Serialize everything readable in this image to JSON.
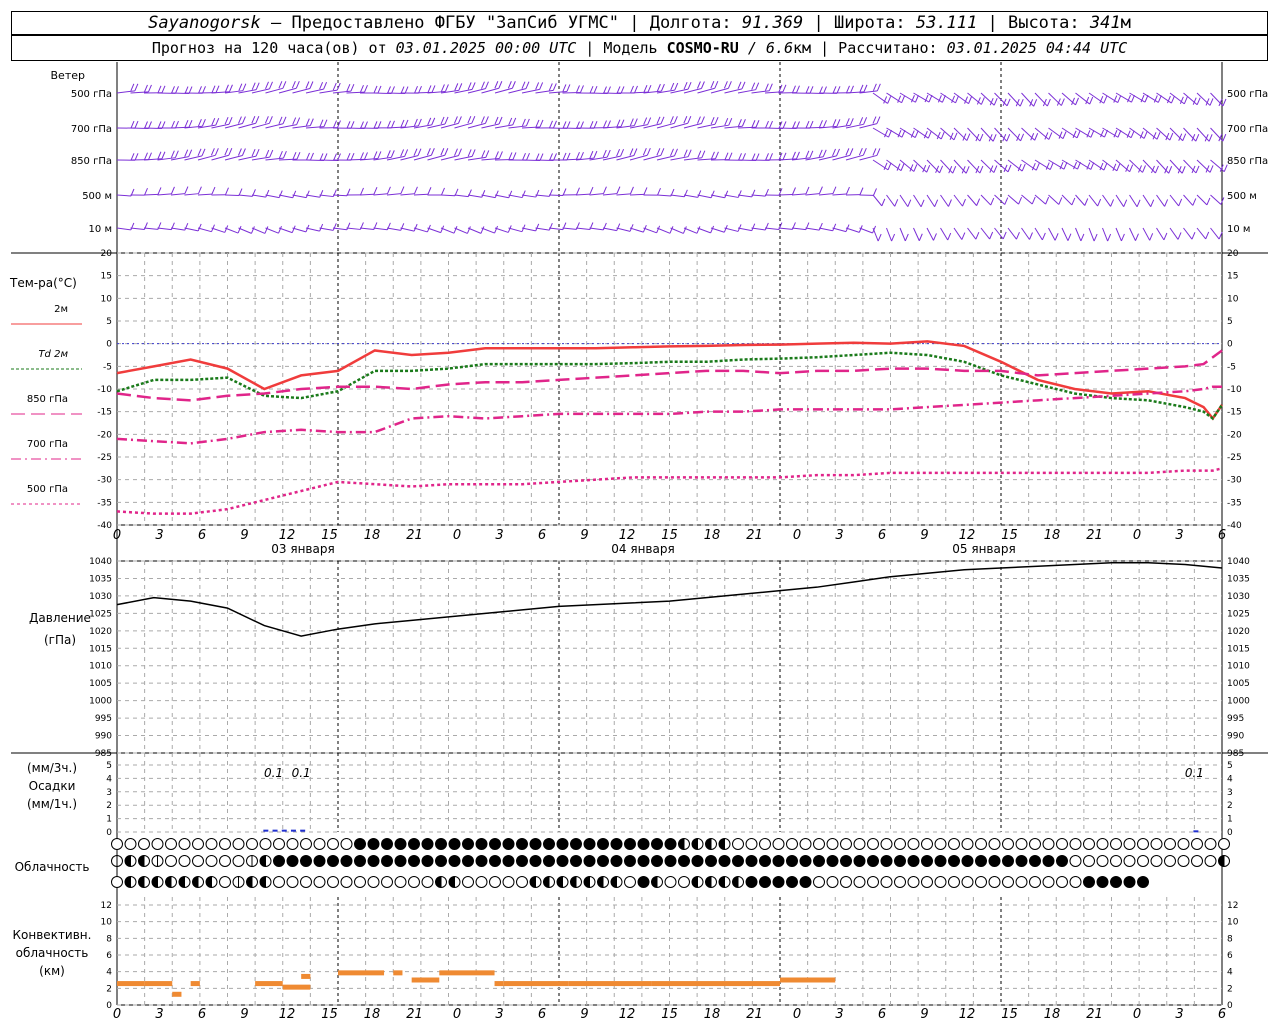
{
  "header": {
    "station": "Sayanogorsk",
    "sep1": " — ",
    "provider": "Предоставлено ФГБУ \"ЗапСиб УГМС\"",
    "lon_label": " | Долгота: ",
    "lon": "91.369",
    "lat_label": " | Широта: ",
    "lat": "53.111",
    "alt_label": " | Высота: ",
    "alt": "341",
    "alt_unit": "м",
    "forecast_label": "Прогноз на 120 часа(ов) от ",
    "forecast_time": "03.01.2025 00:00 UTC",
    "model_label": "  | Модель ",
    "model": "COSMO-RU",
    "model_res": " / 6.6",
    "model_res_unit": "км",
    "calc_label": " | Рассчитано: ",
    "calc_time": "03.01.2025 04:44 UTC"
  },
  "wind_panel": {
    "title": "Ветер",
    "levels": [
      "500 гПа",
      "700 гПа",
      "850 гПа",
      "500 м",
      "10  м"
    ],
    "color": "#7b2fd6"
  },
  "temp_panel": {
    "title": "Тем-ра(°C)",
    "legend": [
      {
        "label": "2м",
        "color": "#f03c3c",
        "dash": "solid"
      },
      {
        "label": "Td  2м",
        "color": "#1a7a1a",
        "dash": "dot"
      },
      {
        "label": "850 гПа",
        "color": "#e0258a",
        "dash": "long"
      },
      {
        "label": "700 гПа",
        "color": "#e0258a",
        "dash": "dashdot"
      },
      {
        "label": "500 гПа",
        "color": "#e0258a",
        "dash": "dense"
      }
    ],
    "yticks": [
      "20",
      "15",
      "10",
      "5",
      "0",
      "-5",
      "-10",
      "-15",
      "-20",
      "-25",
      "-30",
      "-35",
      "-40"
    ]
  },
  "pressure_panel": {
    "title": "Давление",
    "unit": "(гПа)",
    "yticks": [
      "1040",
      "1035",
      "1030",
      "1025",
      "1020",
      "1015",
      "1010",
      "1005",
      "1000",
      "995",
      "990",
      "985"
    ]
  },
  "precip_panel": {
    "unit_top": "(мм/3ч.)",
    "title": "Осадки",
    "unit_bottom": "(мм/1ч.)",
    "yticks": [
      "5",
      "4",
      "3",
      "2",
      "1",
      "0"
    ],
    "labels": [
      {
        "hour": 17,
        "text": "0.1"
      },
      {
        "hour": 20,
        "text": "0.1"
      },
      {
        "hour": 117,
        "text": "0.1"
      }
    ]
  },
  "cloud_panel": {
    "title": "Облачность"
  },
  "conv_panel": {
    "title_1": "Конвективн.",
    "title_2": "облачность",
    "unit": "(км)",
    "yticks": [
      "12",
      "10",
      "8",
      "6",
      "4",
      "2",
      "0"
    ]
  },
  "time_axis": {
    "ticks": [
      "0",
      "3",
      "6",
      "9",
      "12",
      "15",
      "18",
      "21",
      "0",
      "3",
      "6",
      "9",
      "12",
      "15",
      "18",
      "21",
      "0",
      "3",
      "6",
      "9",
      "12",
      "15",
      "18",
      "21",
      "0",
      "3",
      "6"
    ],
    "dates": [
      "03 января",
      "04 января",
      "05 января"
    ]
  },
  "chart_data": {
    "type": "line",
    "x_unit": "hours from 03.01.2025 00:00 UTC",
    "x": [
      0,
      3,
      6,
      9,
      12,
      15,
      18,
      21,
      24,
      27,
      30,
      33,
      36,
      39,
      42,
      45,
      48,
      51,
      54,
      57,
      60,
      63,
      66,
      69,
      72,
      75,
      78,
      81,
      84,
      87,
      90,
      93,
      96,
      99,
      102,
      105,
      108,
      111,
      114,
      117,
      120
    ],
    "temperature": {
      "ylim": [
        -40,
        20
      ],
      "series": [
        {
          "name": "2м",
          "values": [
            -6.5,
            -5,
            -3.5,
            -5.5,
            -10,
            -7,
            -6,
            -1.5,
            -2.5,
            -2,
            -1,
            -1,
            -1,
            -1,
            -0.8,
            -0.6,
            -0.5,
            -0.3,
            -0.2,
            0,
            0.2,
            0,
            0.5,
            -0.5,
            -4,
            -8,
            -10,
            -11,
            -10.5,
            -12,
            -14,
            -16.5,
            -13.5
          ]
        },
        {
          "name": "Td  2м",
          "values": [
            -10.5,
            -8,
            -8,
            -7.5,
            -11.5,
            -12,
            -10.5,
            -6,
            -6,
            -5.5,
            -4.5,
            -4.5,
            -4.5,
            -4.5,
            -4.3,
            -4,
            -4,
            -3.5,
            -3.3,
            -3,
            -2.5,
            -2,
            -2.5,
            -4,
            -7,
            -9,
            -11,
            -12,
            -12.5,
            -14,
            -15,
            -16.5,
            -13.5
          ]
        },
        {
          "name": "850 гПа",
          "values": [
            -11,
            -12,
            -12.5,
            -11.5,
            -11,
            -10,
            -9.5,
            -9.5,
            -10,
            -9,
            -8.5,
            -8.5,
            -8,
            -7.5,
            -7,
            -6.5,
            -6,
            -6,
            -6.5,
            -6,
            -6,
            -5.5,
            -5.5,
            -6,
            -6,
            -7,
            -6.5,
            -6,
            -5.5,
            -5,
            -4.5,
            -3,
            -1.5
          ]
        },
        {
          "name": "700 гПа",
          "values": [
            -21,
            -21.5,
            -22,
            -21,
            -19.5,
            -19,
            -19.5,
            -19.5,
            -16.5,
            -16,
            -16.5,
            -16,
            -15.5,
            -15.5,
            -15.5,
            -15.5,
            -15,
            -15,
            -14.5,
            -14.5,
            -14.5,
            -14.5,
            -14,
            -13.5,
            -13,
            -12.5,
            -12,
            -11.5,
            -11,
            -10.5,
            -10,
            -9.5,
            -9.5
          ]
        },
        {
          "name": "500 гПа",
          "values": [
            -37,
            -37.5,
            -37.5,
            -36.5,
            -34.5,
            -32.5,
            -30.5,
            -31,
            -31.5,
            -31,
            -31,
            -31,
            -30.5,
            -30,
            -29.5,
            -29.5,
            -29.5,
            -29.5,
            -29.5,
            -29,
            -29,
            -28.5,
            -28.5,
            -28.5,
            -28.5,
            -28.5,
            -28.5,
            -28.5,
            -28.5,
            -28,
            -28,
            -28,
            -27.5
          ]
        }
      ],
      "x": [
        0,
        4,
        8,
        12,
        16,
        20,
        24,
        28,
        32,
        36,
        40,
        44,
        48,
        52,
        56,
        60,
        64,
        68,
        72,
        76,
        80,
        84,
        88,
        92,
        96,
        100,
        104,
        108,
        112,
        116,
        118,
        119,
        120
      ]
    },
    "pressure": {
      "ylim": [
        985,
        1040
      ],
      "x": [
        0,
        4,
        8,
        12,
        16,
        20,
        24,
        28,
        32,
        36,
        40,
        44,
        48,
        52,
        56,
        60,
        64,
        68,
        72,
        76,
        80,
        84,
        88,
        92,
        96,
        100,
        104,
        108,
        112,
        116,
        120
      ],
      "values": [
        1027.5,
        1029.5,
        1028.5,
        1026.5,
        1021.5,
        1018.5,
        1020.5,
        1022,
        1023,
        1024,
        1025,
        1026,
        1027,
        1027.5,
        1028,
        1028.5,
        1029.5,
        1030.5,
        1031.5,
        1032.5,
        1034,
        1035.5,
        1036.5,
        1037.5,
        1038,
        1038.5,
        1039,
        1039.5,
        1039.5,
        1039,
        1038
      ]
    },
    "precipitation": {
      "ylim": [
        0,
        5
      ],
      "x": [
        16,
        17,
        18,
        19,
        20,
        117
      ],
      "values": [
        0.1,
        0.1,
        0.1,
        0.1,
        0.1,
        0.05
      ]
    },
    "convective_cloud_km": {
      "ylim": [
        0,
        14
      ],
      "segments": [
        {
          "x0": 0,
          "x1": 3,
          "y": 3
        },
        {
          "x0": 3,
          "x1": 6,
          "y": 3
        },
        {
          "x0": 6,
          "x1": 7,
          "y": 1.5
        },
        {
          "x0": 8,
          "x1": 9,
          "y": 3
        },
        {
          "x0": 15,
          "x1": 18,
          "y": 3
        },
        {
          "x0": 18,
          "x1": 21,
          "y": 2.5
        },
        {
          "x0": 20,
          "x1": 21,
          "y": 4
        },
        {
          "x0": 24,
          "x1": 29,
          "y": 4.5
        },
        {
          "x0": 30,
          "x1": 31,
          "y": 4.5
        },
        {
          "x0": 32,
          "x1": 35,
          "y": 3.5
        },
        {
          "x0": 35,
          "x1": 41,
          "y": 4.5
        },
        {
          "x0": 41,
          "x1": 42,
          "y": 3
        },
        {
          "x0": 42,
          "x1": 49,
          "y": 3
        },
        {
          "x0": 49,
          "x1": 58,
          "y": 3
        },
        {
          "x0": 58,
          "x1": 72,
          "y": 3
        },
        {
          "x0": 72,
          "x1": 78,
          "y": 3.5
        }
      ]
    },
    "cloud_cover_rows": [
      "00000000000000000044444444444444444444444433320000000000000000000000000000000000000",
      "12210000001244444444444444444444444444444444444444444444444444444444444000000000003",
      "02222222013200000000000022000002222222042002232444440000000000000000000044444"
    ]
  }
}
